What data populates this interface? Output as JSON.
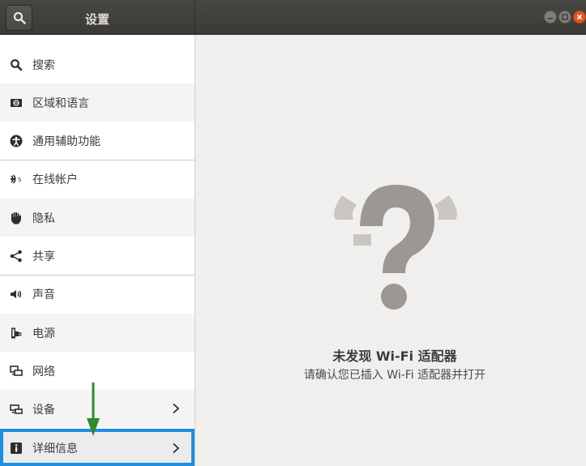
{
  "header": {
    "title": "设置"
  },
  "sidebar": {
    "items": [
      {
        "label": "搜索",
        "icon": "search-icon"
      },
      {
        "label": "区域和语言",
        "icon": "region-icon"
      },
      {
        "label": "通用辅助功能",
        "icon": "accessibility-icon"
      },
      {
        "label": "在线帐户",
        "icon": "online-accounts-icon"
      },
      {
        "label": "隐私",
        "icon": "hand-icon"
      },
      {
        "label": "共享",
        "icon": "share-icon"
      },
      {
        "label": "声音",
        "icon": "speaker-icon"
      },
      {
        "label": "电源",
        "icon": "power-icon"
      },
      {
        "label": "网络",
        "icon": "network-icon"
      },
      {
        "label": "设备",
        "icon": "devices-icon",
        "has_submenu": true
      },
      {
        "label": "详细信息",
        "icon": "info-icon",
        "has_submenu": true,
        "selected": true
      }
    ]
  },
  "content": {
    "title": "未发现 Wi-Fi 适配器",
    "subtitle": "请确认您已插入 Wi-Fi 适配器并打开"
  },
  "colors": {
    "header_bg": "#3b3a37",
    "accent_orange": "#e95420",
    "highlight_blue": "#1f8ee0",
    "annotation_green": "#2e8b2e",
    "placeholder_gray": "#9b9792"
  }
}
